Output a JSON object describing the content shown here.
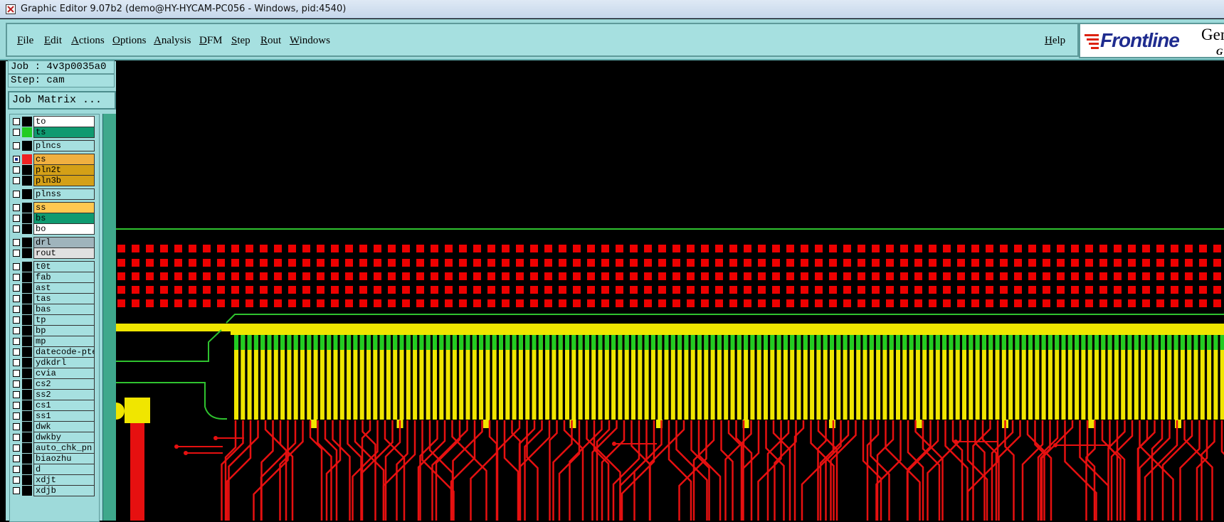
{
  "window": {
    "title": "Graphic Editor 9.07b2 (demo@HY-HYCAM-PC056 - Windows, pid:4540)"
  },
  "menu": [
    "File",
    "Edit",
    "Actions",
    "Options",
    "Analysis",
    "DFM",
    "Step",
    "Rout",
    "Windows"
  ],
  "help_label": "Help",
  "logo": {
    "brand": "Frontline",
    "gen": "Gen",
    "gen_sub": "G"
  },
  "job": {
    "job_label": "Job : 4v3p0035a0",
    "step_label": "Step: cam",
    "matrix_button": "Job Matrix ..."
  },
  "layers": [
    {
      "name": "to",
      "color": "#ffffff",
      "swatch": "#000000",
      "checked": false
    },
    {
      "name": "ts",
      "color": "#0f9a70",
      "swatch": "#22cc22",
      "checked": false
    },
    {
      "name": "plncs",
      "color": "#a6e0e0",
      "swatch": "#000000",
      "checked": false
    },
    {
      "name": "cs",
      "color": "#f0b040",
      "swatch": "#ee2222",
      "checked": true
    },
    {
      "name": "pln2t",
      "color": "#d4a017",
      "swatch": "#000000",
      "checked": false
    },
    {
      "name": "pln3b",
      "color": "#d4a017",
      "swatch": "#000000",
      "checked": false
    },
    {
      "name": "plnss",
      "color": "#a6e0e0",
      "swatch": "#000000",
      "checked": false
    },
    {
      "name": "ss",
      "color": "#ffc850",
      "swatch": "#000000",
      "checked": false
    },
    {
      "name": "bs",
      "color": "#0f9a70",
      "swatch": "#000000",
      "checked": false
    },
    {
      "name": "bo",
      "color": "#ffffff",
      "swatch": "#000000",
      "checked": false
    },
    {
      "name": "drl",
      "color": "#9fb4bc",
      "swatch": "#000000",
      "checked": false
    },
    {
      "name": "rout",
      "color": "#e0e0e0",
      "swatch": "#000000",
      "checked": false
    },
    {
      "name": "t0t",
      "color": "#a6e0e0",
      "swatch": "#000000",
      "checked": false
    },
    {
      "name": "fab",
      "color": "#a6e0e0",
      "swatch": "#000000",
      "checked": false
    },
    {
      "name": "ast",
      "color": "#a6e0e0",
      "swatch": "#000000",
      "checked": false
    },
    {
      "name": "tas",
      "color": "#a6e0e0",
      "swatch": "#000000",
      "checked": false
    },
    {
      "name": "bas",
      "color": "#a6e0e0",
      "swatch": "#000000",
      "checked": false
    },
    {
      "name": "tp",
      "color": "#a6e0e0",
      "swatch": "#000000",
      "checked": false
    },
    {
      "name": "bp",
      "color": "#a6e0e0",
      "swatch": "#000000",
      "checked": false
    },
    {
      "name": "mp",
      "color": "#a6e0e0",
      "swatch": "#000000",
      "checked": false
    },
    {
      "name": "datecode-pte",
      "color": "#a6e0e0",
      "swatch": "#000000",
      "checked": false
    },
    {
      "name": "ydkdrl",
      "color": "#a6e0e0",
      "swatch": "#000000",
      "checked": false
    },
    {
      "name": "cvia",
      "color": "#a6e0e0",
      "swatch": "#000000",
      "checked": false
    },
    {
      "name": "cs2",
      "color": "#a6e0e0",
      "swatch": "#000000",
      "checked": false
    },
    {
      "name": "ss2",
      "color": "#a6e0e0",
      "swatch": "#000000",
      "checked": false
    },
    {
      "name": "cs1",
      "color": "#a6e0e0",
      "swatch": "#000000",
      "checked": false
    },
    {
      "name": "ss1",
      "color": "#a6e0e0",
      "swatch": "#000000",
      "checked": false
    },
    {
      "name": "dwk",
      "color": "#a6e0e0",
      "swatch": "#000000",
      "checked": false
    },
    {
      "name": "dwkby",
      "color": "#a6e0e0",
      "swatch": "#000000",
      "checked": false
    },
    {
      "name": "auto_chk_pn",
      "color": "#a6e0e0",
      "swatch": "#000000",
      "checked": false
    },
    {
      "name": "biaozhu",
      "color": "#a6e0e0",
      "swatch": "#000000",
      "checked": false
    },
    {
      "name": "d",
      "color": "#a6e0e0",
      "swatch": "#000000",
      "checked": false
    },
    {
      "name": "xdjt",
      "color": "#a6e0e0",
      "swatch": "#000000",
      "checked": false
    },
    {
      "name": "xdjb",
      "color": "#a6e0e0",
      "swatch": "#000000",
      "checked": false
    }
  ],
  "colors": {
    "pad_red": "#ee0000",
    "finger_yellow": "#f0e600",
    "finger_green": "#22cc22",
    "outline_green": "#2fc22f",
    "trace_red": "#e61010",
    "canvas_bg": "#000000"
  }
}
